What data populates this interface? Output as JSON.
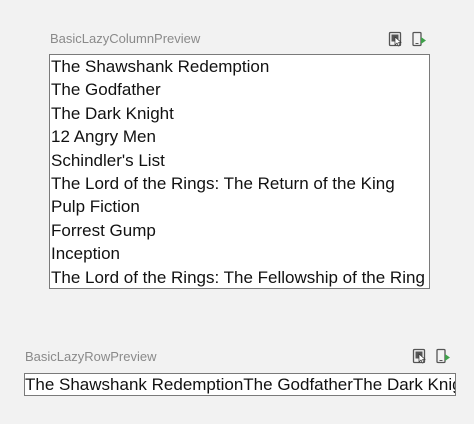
{
  "column_preview": {
    "title": "BasicLazyColumnPreview",
    "items": [
      "The Shawshank Redemption",
      "The Godfather",
      "The Dark Knight",
      "12 Angry Men",
      "Schindler's List",
      "The Lord of the Rings: The Return of the King",
      "Pulp Fiction",
      "Forrest Gump",
      "Inception",
      "The Lord of the Rings: The Fellowship of the Ring"
    ],
    "icons": [
      "interactive-mode-icon",
      "deploy-to-device-icon"
    ]
  },
  "row_preview": {
    "title": "BasicLazyRowPreview",
    "items": [
      "The Shawshank Redemption",
      "The Godfather",
      "The Dark Knight"
    ],
    "icons": [
      "interactive-mode-icon",
      "deploy-to-device-icon"
    ]
  },
  "colors": {
    "background": "#f2f2f2",
    "title_text": "#8a8a8a",
    "frame_border": "#7a7a7a",
    "item_text": "#111111",
    "deploy_accent": "#3fa04a"
  }
}
